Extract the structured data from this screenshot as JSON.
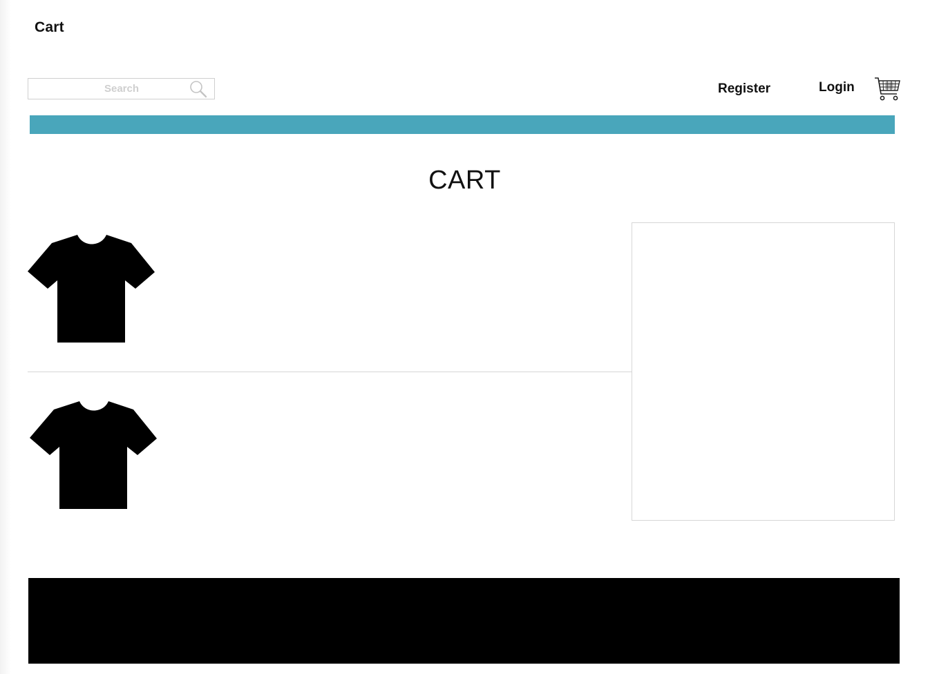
{
  "app": {
    "title": "Cart"
  },
  "header": {
    "search": {
      "placeholder": "Search",
      "icon": "magnifier"
    },
    "register_label": "Register",
    "login_label": "Login",
    "cart_icon": "shopping-cart"
  },
  "theme": {
    "accent_color": "#49a6bb",
    "footer_color": "#000000"
  },
  "main": {
    "heading": "CART",
    "items": [
      {
        "image": "t-shirt",
        "color": "#000000"
      },
      {
        "image": "t-shirt",
        "color": "#000000"
      }
    ]
  }
}
